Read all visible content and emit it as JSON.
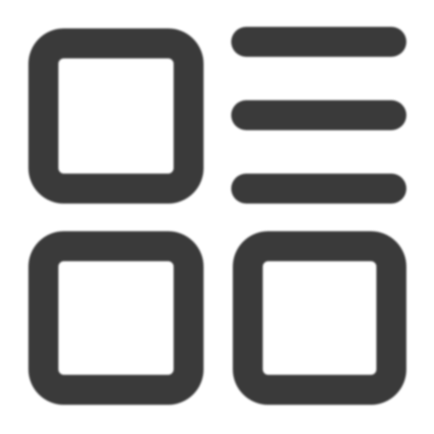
{
  "icon": {
    "name": "grid-list-layout-icon",
    "color": "#3a3a3a",
    "background": "#ffffff"
  }
}
